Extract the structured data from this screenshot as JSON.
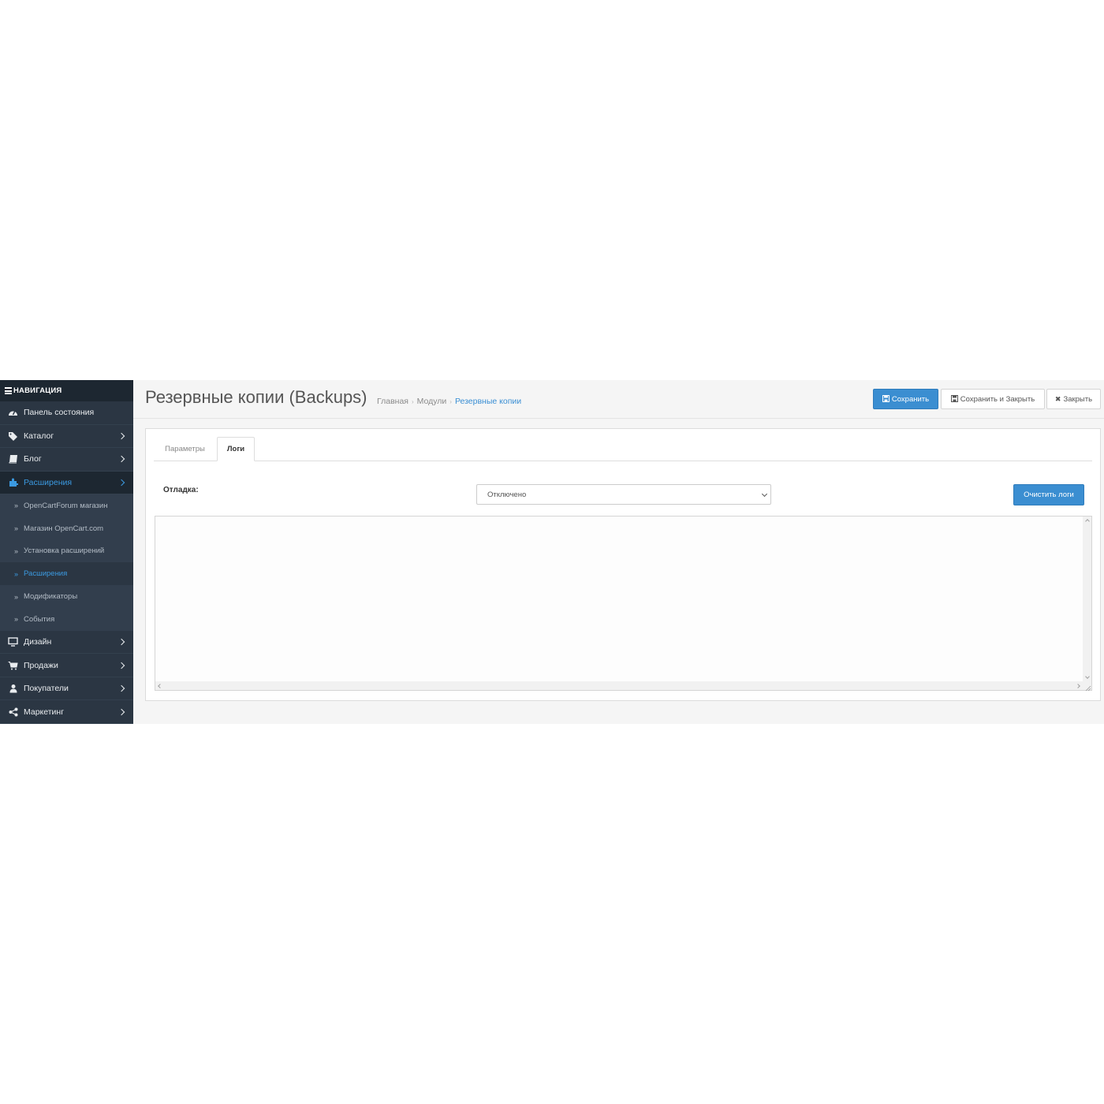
{
  "sidebar": {
    "header": "НАВИГАЦИЯ",
    "items": [
      {
        "label": "Панель состояния",
        "icon": "dashboard-icon"
      },
      {
        "label": "Каталог",
        "icon": "tags-icon"
      },
      {
        "label": "Блог",
        "icon": "book-icon"
      },
      {
        "label": "Расширения",
        "icon": "puzzle-icon"
      }
    ],
    "submenu": [
      {
        "label": "OpenCartForum магазин"
      },
      {
        "label": "Магазин OpenCart.com"
      },
      {
        "label": "Установка расширений"
      },
      {
        "label": "Расширения"
      },
      {
        "label": "Модификаторы"
      },
      {
        "label": "События"
      }
    ],
    "items_after": [
      {
        "label": "Дизайн",
        "icon": "desktop-icon"
      },
      {
        "label": "Продажи",
        "icon": "shopping-cart-icon"
      },
      {
        "label": "Покупатели",
        "icon": "user-icon"
      },
      {
        "label": "Маркетинг",
        "icon": "share-icon"
      }
    ]
  },
  "header": {
    "title": "Резервные копии (Backups)",
    "breadcrumb": [
      "Главная",
      "Модули",
      "Резервные копии"
    ],
    "buttons": {
      "save": "Сохранить",
      "save_close": "Сохранить и Закрыть",
      "close": "Закрыть"
    }
  },
  "tabs": [
    "Параметры",
    "Логи"
  ],
  "form": {
    "debug_label": "Отладка:",
    "debug_value": "Отключено",
    "clear_logs": "Очистить логи",
    "log_text": ""
  },
  "colors": {
    "sidebar_bg": "#2b3643",
    "accent": "#3b8ed1",
    "active_link": "#3b9ae1"
  }
}
